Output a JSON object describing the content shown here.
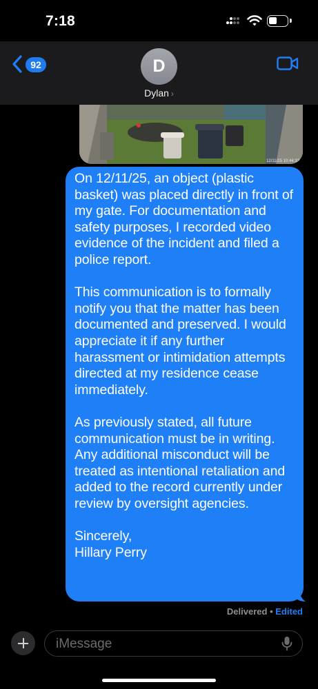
{
  "status_bar": {
    "time": "7:18"
  },
  "header": {
    "back_badge": "92",
    "avatar_initial": "D",
    "contact_name": "Dylan",
    "contact_chevron": "›",
    "icons": [
      "chevron-left-icon",
      "video-camera-icon"
    ],
    "accent_color": "#1f7ff6"
  },
  "thread": {
    "photo_timestamp": "12/11/25 10:44:33",
    "message_paragraphs": [
      "On 12/11/25, an object (plastic basket) was placed directly in front of my gate. For documentation and safety purposes, I recorded video evidence of the incident and filed a police report.",
      "This communication is to formally notify you that the matter has been documented and preserved. I would appreciate it if any further harassment or intimidation attempts directed at my residence cease immediately.",
      "As previously stated, all future communication must be in writing. Any additional misconduct will be treated as intentional retaliation and added to the record currently under review by oversight agencies.",
      "Sincerely,\nHillary Perry"
    ],
    "receipt_status": "Delivered",
    "receipt_separator": "•",
    "receipt_edited": "Edited"
  },
  "compose": {
    "placeholder": "iMessage",
    "icons": [
      "plus-icon",
      "microphone-icon"
    ]
  }
}
